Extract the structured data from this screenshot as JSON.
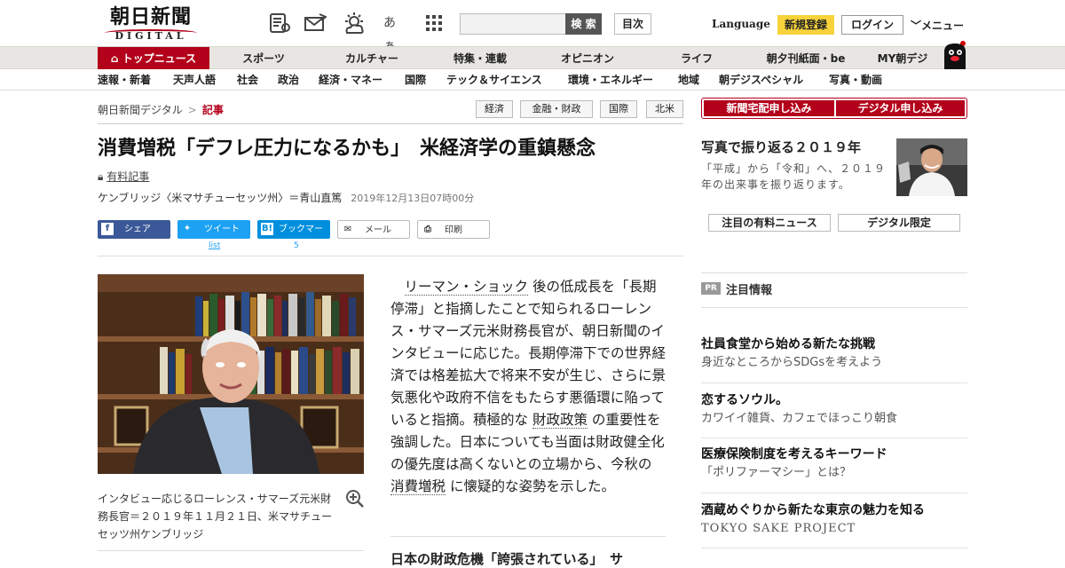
{
  "header": {
    "logo_ja": "朝日新聞",
    "logo_en": "DIGITAL",
    "icons": [
      "paper-icon",
      "mail-icon",
      "weather-icon",
      "font-size-icon",
      "grid-icon"
    ],
    "font_size_glyph": "あぁ",
    "search_placeholder": "",
    "search_button": "検 索",
    "toc_button": "目次",
    "language": "Language",
    "register": "新規登録",
    "login": "ログイン",
    "menu": "メニュー"
  },
  "nav_primary": [
    "トップニュース",
    "スポーツ",
    "カルチャー",
    "特集・連載",
    "オピニオン",
    "ライフ",
    "朝夕刊紙面・be",
    "MY朝デジ"
  ],
  "nav_secondary": [
    "速報・新着",
    "天声人語",
    "社会",
    "政治",
    "経済・マネー",
    "国際",
    "テック＆サイエンス",
    "環境・エネルギー",
    "地域",
    "朝デジスペシャル",
    "写真・動画"
  ],
  "breadcrumb": {
    "home": "朝日新聞デジタル",
    "sep": ">",
    "current": "記事"
  },
  "tags": [
    "経済",
    "金融・財政",
    "国際",
    "北米"
  ],
  "article": {
    "title": "消費増税「デフレ圧力になるかも」　米経済学の重鎮懸念",
    "paid_label": "有料記事",
    "byline": "ケンブリッジ〈米マサチューセッツ州〉＝青山直篤",
    "date": "2019年12月13日07時00分",
    "caption": "インタビュー応じるローレンス・サマーズ元米財務長官＝２０１９年１１月２１日、米マサチューセッツ州ケンブリッジ",
    "body_link1": "リーマン・ショック",
    "body_part1": "後の低成長を「長期停滞」と指摘したことで知られるローレンス・サマーズ元米財務長官が、朝日新聞のインタビューに応じた。長期停滞下での世界経済では格差拡大で将来不安が生じ、さらに景気悪化や政府不信をもたらす悪循環に陥っていると指摘。積極的な",
    "body_link2": "財政政策",
    "body_part2": "の重要性を強調した。日本についても当面は財政健全化の優先度は高くないとの立場から、今秋の",
    "body_link3": "消費増税",
    "body_part3": "に懐疑的な姿勢を示した。",
    "subhead": "日本の財政危機「誇張されている」　サ"
  },
  "share": {
    "facebook": "シェア",
    "twitter": "ツイート",
    "twitter_sub": "list",
    "hatena": "ブックマーク",
    "hatena_count": "5",
    "mail": "メール",
    "print": "印刷"
  },
  "sidebar": {
    "subscribe_paper": "新聞宅配申し込み",
    "subscribe_digital": "デジタル申し込み",
    "feature_title": "写真で振り返る２０１９年",
    "feature_desc": "「平成」から「令和」へ、２０１９年の出来事を振り返ります。",
    "pill_paid": "注目の有料ニュース",
    "pill_digital": "デジタル限定",
    "pr_badge": "PR",
    "pr_label": "注目情報",
    "pr_items": [
      {
        "title": "社員食堂から始める新たな挑戦",
        "sub": "身近なところからSDGsを考えよう"
      },
      {
        "title": "恋するソウル。",
        "sub": "カワイイ雑貨、カフェでほっこり朝食"
      },
      {
        "title": "医療保険制度を考えるキーワード",
        "sub": "「ポリファーマシー」とは？"
      },
      {
        "title": "酒蔵めぐりから新たな東京の魅力を知る",
        "sub": "TOKYO SAKE PROJECT"
      }
    ]
  },
  "colors": {
    "brand_red": "#b3001b",
    "yellow": "#f7d23a",
    "facebook": "#3b5998",
    "twitter": "#1da1f2",
    "hatena": "#008fde"
  }
}
